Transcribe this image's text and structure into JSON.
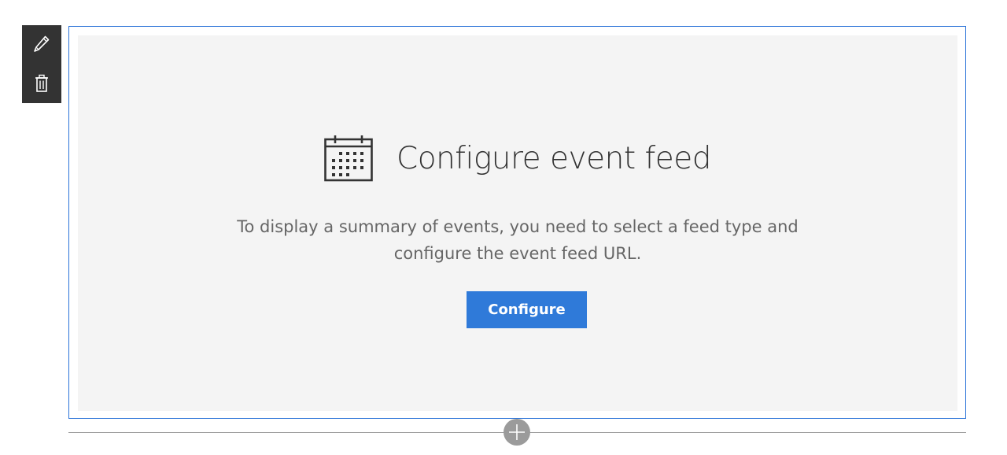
{
  "toolbar": {
    "edit_icon": "pencil-icon",
    "delete_icon": "trash-icon"
  },
  "placeholder": {
    "icon": "calendar-icon",
    "title": "Configure event feed",
    "description_line1": "To display a summary of events, you need to select a feed type and",
    "description_line2": "configure the event feed URL.",
    "button_label": "Configure"
  },
  "divider": {
    "add_icon": "plus-icon"
  },
  "colors": {
    "accent": "#2f7ad9",
    "frame_border": "#2b73d8",
    "toolbar_bg": "#333333",
    "placeholder_bg": "#f4f4f4",
    "add_button": "#9b9b9b"
  }
}
